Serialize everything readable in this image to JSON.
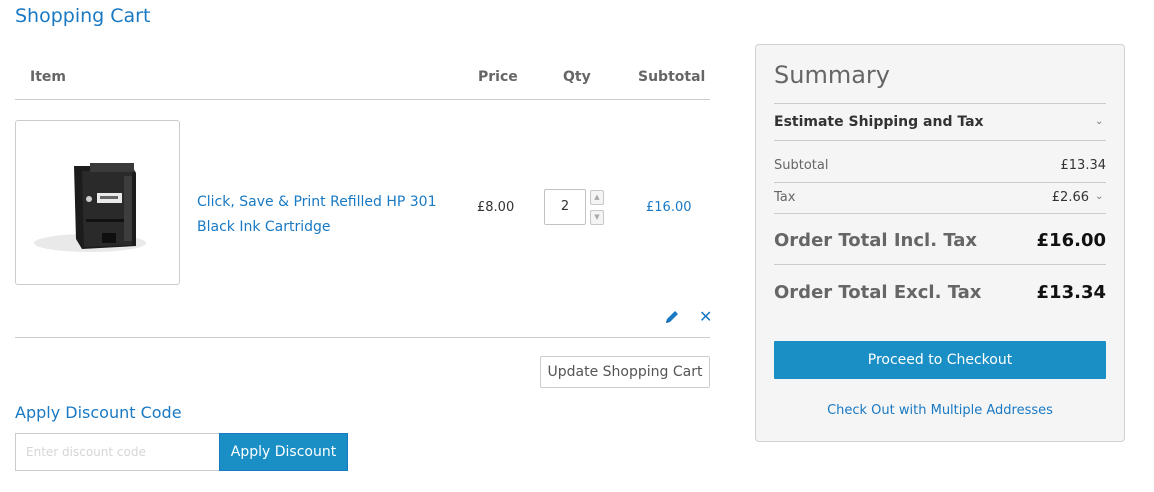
{
  "page": {
    "title": "Shopping Cart"
  },
  "cart": {
    "columns": {
      "item": "Item",
      "price": "Price",
      "qty": "Qty",
      "subtotal": "Subtotal"
    },
    "items": [
      {
        "name": "Click, Save & Print Refilled HP 301 Black Ink Cartridge",
        "price": "£8.00",
        "qty": "2",
        "subtotal": "£16.00",
        "thumbnail_icon": "ink-cartridge-image"
      }
    ],
    "actions": {
      "edit_icon": "pencil-icon",
      "remove_icon": "close-icon"
    },
    "update_label": "Update Shopping Cart"
  },
  "discount": {
    "title": "Apply Discount Code",
    "placeholder": "Enter discount code",
    "button_label": "Apply Discount"
  },
  "summary": {
    "title": "Summary",
    "estimate_label": "Estimate Shipping and Tax",
    "subtotal_label": "Subtotal",
    "subtotal_value": "£13.34",
    "tax_label": "Tax",
    "tax_value": "£2.66",
    "total_incl_label": "Order Total Incl. Tax",
    "total_incl_value": "£16.00",
    "total_excl_label": "Order Total Excl. Tax",
    "total_excl_value": "£13.34",
    "checkout_label": "Proceed to Checkout",
    "multi_label": "Check Out with Multiple Addresses"
  },
  "colors": {
    "accent": "#1979c3",
    "button": "#1a8fc5"
  }
}
